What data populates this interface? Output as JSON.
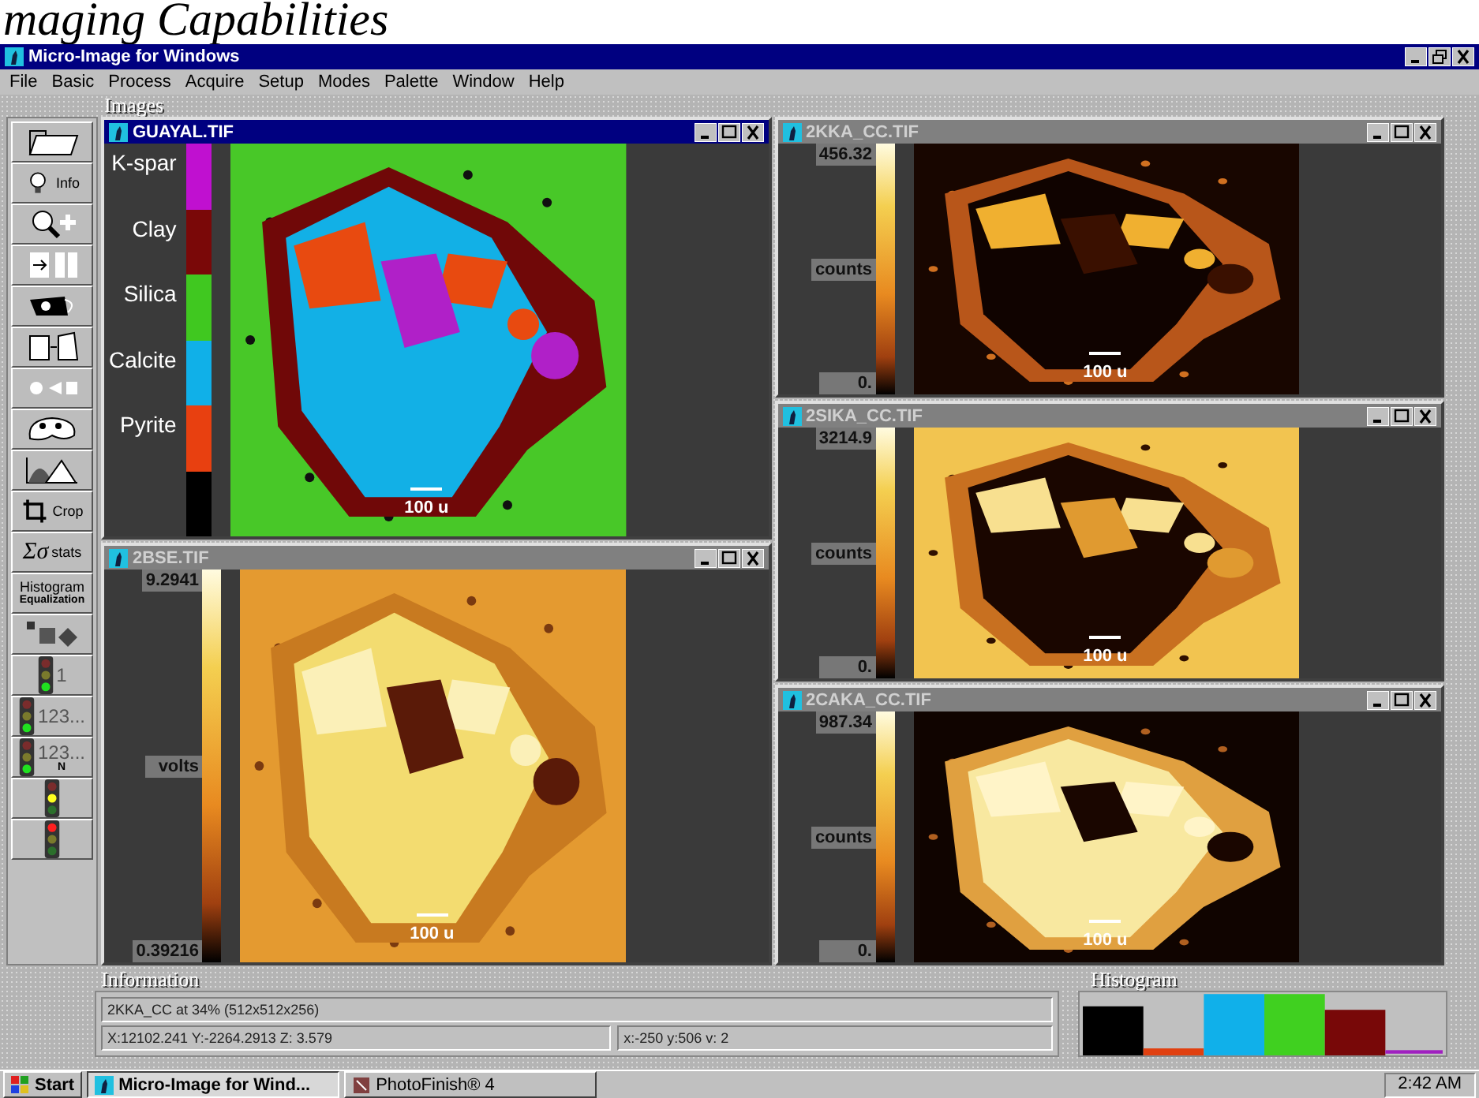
{
  "heading": "maging Capabilities",
  "window": {
    "title": "Micro-Image for Windows"
  },
  "menu": [
    "File",
    "Basic",
    "Process",
    "Acquire",
    "Setup",
    "Modes",
    "Palette",
    "Window",
    "Help"
  ],
  "images_label": "Images",
  "toolbar": {
    "info_label": "Info",
    "crop_label": "Crop",
    "stats_symbol": "Σσ",
    "stats_label": "stats",
    "equalize_label": "Histogram",
    "equalize_sublabel": "Equalization",
    "count_tools": [
      {
        "label": "1"
      },
      {
        "label": "123..."
      },
      {
        "label": "123...",
        "sublabel": "N"
      }
    ]
  },
  "left_windows": [
    {
      "title": "GUAYAL.TIF",
      "active": true,
      "kind": "legend",
      "scale_label": "100 u",
      "legend": [
        {
          "label": "K-spar",
          "color": "#c010d0"
        },
        {
          "label": "Clay",
          "color": "#7a0808"
        },
        {
          "label": "Silica",
          "color": "#40c820"
        },
        {
          "label": "Calcite",
          "color": "#10b0e8"
        },
        {
          "label": "Pyrite",
          "color": "#e84010"
        },
        {
          "color": "#000000"
        }
      ]
    },
    {
      "title": "2BSE.TIF",
      "active": false,
      "kind": "colorbar",
      "scale_label": "100 u",
      "max": "9.2941",
      "unit": "volts",
      "min": "0.39216"
    }
  ],
  "right_windows": [
    {
      "title": "2KKA_CC.TIF",
      "active": false,
      "kind": "colorbar",
      "scale_label": "100 u",
      "max": "456.32",
      "unit": "counts",
      "min": "0."
    },
    {
      "title": "2SIKA_CC.TIF",
      "active": false,
      "kind": "colorbar",
      "scale_label": "100 u",
      "max": "3214.9",
      "unit": "counts",
      "min": "0."
    },
    {
      "title": "2CAKA_CC.TIF",
      "active": false,
      "kind": "colorbar",
      "scale_label": "100 u",
      "max": "987.34",
      "unit": "counts",
      "min": "0."
    }
  ],
  "information": {
    "label": "Information",
    "line": "2KKA_CC at 34% (512x512x256)",
    "coords": "X:12102.241 Y:-2264.2913 Z: 3.579",
    "pixel": "x:-250 y:506 v: 2"
  },
  "histogram": {
    "label": "Histogram"
  },
  "taskbar": {
    "start": "Start",
    "tasks": [
      {
        "label": "Micro-Image for Wind...",
        "selected": true
      },
      {
        "label": "PhotoFinish® 4",
        "selected": false
      }
    ],
    "clock": "2:42 AM"
  }
}
